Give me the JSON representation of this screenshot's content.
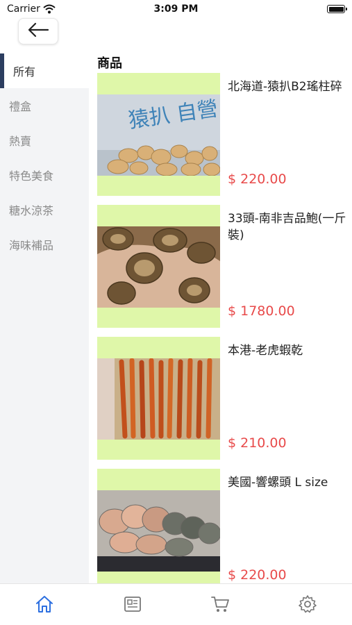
{
  "status": {
    "carrier": "Carrier",
    "time": "3:09 PM"
  },
  "header": {
    "back_icon": "arrow-left-icon"
  },
  "sidebar": {
    "items": [
      {
        "label": "所有",
        "active": true
      },
      {
        "label": "禮盒",
        "active": false
      },
      {
        "label": "熱賣",
        "active": false
      },
      {
        "label": "特色美食",
        "active": false
      },
      {
        "label": "糖水涼茶",
        "active": false
      },
      {
        "label": "海味補品",
        "active": false
      }
    ]
  },
  "main": {
    "title": "商品",
    "products": [
      {
        "name": "北海道-猿扒B2瑤柱碎",
        "price": "$ 220.00",
        "image_text": "猿扒 自營"
      },
      {
        "name": "33頭-南非吉品鮑(一斤裝)",
        "price": "$ 1780.00"
      },
      {
        "name": "本港-老虎蝦乾",
        "price": "$ 210.00"
      },
      {
        "name": "美國-響螺頭 L size",
        "price": "$ 220.00"
      }
    ]
  },
  "tabbar": {
    "tabs": [
      {
        "icon": "home-icon",
        "active": true
      },
      {
        "icon": "news-icon",
        "active": false
      },
      {
        "icon": "cart-icon",
        "active": false
      },
      {
        "icon": "settings-icon",
        "active": false
      }
    ]
  },
  "colors": {
    "accent": "#2c6fe0",
    "price": "#e84a4a",
    "image_bg": "#dff7a9",
    "sidebar_bg": "#f3f4f6",
    "active_indicator": "#2c3e60"
  }
}
